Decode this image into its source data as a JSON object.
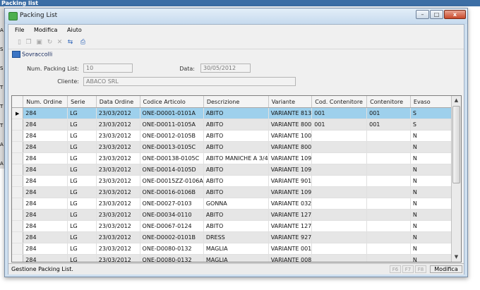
{
  "background": {
    "title": "Packing list",
    "strip_letters": [
      "A",
      "S",
      "S",
      "T",
      "T",
      "T",
      "A",
      "A"
    ]
  },
  "window": {
    "title": "Packing List",
    "close_glyph": "x",
    "minimize_glyph": "–",
    "maximize_glyph": "□"
  },
  "menu": {
    "items": [
      "File",
      "Modifica",
      "Aiuto"
    ]
  },
  "toolbar": {
    "icons": [
      {
        "name": "new-icon",
        "glyph": "▯"
      },
      {
        "name": "copy-icon",
        "glyph": "❐"
      },
      {
        "name": "save-icon",
        "glyph": "▣"
      },
      {
        "name": "refresh-icon",
        "glyph": "↻"
      },
      {
        "name": "delete-icon",
        "glyph": "✕"
      },
      {
        "name": "export-icon",
        "glyph": "⇆"
      },
      {
        "name": "print-icon",
        "glyph": "⎙"
      }
    ]
  },
  "section": {
    "label": "Sovraccolli"
  },
  "form": {
    "num_packing_label": "Num. Packing List:",
    "num_packing_value": "10",
    "data_label": "Data:",
    "data_value": "30/05/2012",
    "cliente_label": "Cliente:",
    "cliente_value": "ABACO SRL"
  },
  "grid": {
    "columns": [
      "Num. Ordine",
      "Serie",
      "Data Ordine",
      "Codice Articolo",
      "Descrizione",
      "Variante",
      "Cod. Contenitore",
      "Contenitore",
      "Evaso"
    ],
    "selected_marker": "▶",
    "rows": [
      [
        "284",
        "LG",
        "23/03/2012",
        "ONE-D0001-0101A",
        "ABITO",
        "VARIANTE 813",
        "001",
        "001",
        "S"
      ],
      [
        "284",
        "LG",
        "23/03/2012",
        "ONE-D0011-0105A",
        "ABITO",
        "VARIANTE 800",
        "001",
        "001",
        "S"
      ],
      [
        "284",
        "LG",
        "23/03/2012",
        "ONE-D0012-0105B",
        "ABITO",
        "VARIANTE 100",
        "",
        "",
        "N"
      ],
      [
        "284",
        "LG",
        "23/03/2012",
        "ONE-D0013-0105C",
        "ABITO",
        "VARIANTE 800",
        "",
        "",
        "N"
      ],
      [
        "284",
        "LG",
        "23/03/2012",
        "ONE-D00138-0105C",
        "ABITO MANICHE A 3/4",
        "VARIANTE 109",
        "",
        "",
        "N"
      ],
      [
        "284",
        "LG",
        "23/03/2012",
        "ONE-D0014-0105D",
        "ABITO",
        "VARIANTE 109",
        "",
        "",
        "N"
      ],
      [
        "284",
        "LG",
        "23/03/2012",
        "ONE-D0015ZZ-0106A",
        "ABITO",
        "VARIANTE 901",
        "",
        "",
        "N"
      ],
      [
        "284",
        "LG",
        "23/03/2012",
        "ONE-D0016-0106B",
        "ABITO",
        "VARIANTE 109",
        "",
        "",
        "N"
      ],
      [
        "284",
        "LG",
        "23/03/2012",
        "ONE-D0027-0103",
        "GONNA",
        "VARIANTE 032",
        "",
        "",
        "N"
      ],
      [
        "284",
        "LG",
        "23/03/2012",
        "ONE-D0034-0110",
        "ABITO",
        "VARIANTE 127",
        "",
        "",
        "N"
      ],
      [
        "284",
        "LG",
        "23/03/2012",
        "ONE-D0067-0124",
        "ABITO",
        "VARIANTE 127",
        "",
        "",
        "N"
      ],
      [
        "284",
        "LG",
        "23/03/2012",
        "ONE-D0002-0101B",
        "DRESS",
        "VARIANTE 927",
        "",
        "",
        "N"
      ],
      [
        "284",
        "LG",
        "23/03/2012",
        "ONE-D0080-0132",
        "MAGLIA",
        "VARIANTE 001",
        "",
        "",
        "N"
      ],
      [
        "284",
        "LG",
        "23/03/2012",
        "ONE-D0080-0132",
        "MAGLIA",
        "VARIANTE 008",
        "",
        "",
        "N"
      ]
    ],
    "scroll_up": "▲",
    "scroll_down": "▼"
  },
  "status": {
    "text": "Gestione Packing List.",
    "keys": [
      "F6",
      "F7",
      "F8"
    ],
    "mode": "Modifica"
  }
}
